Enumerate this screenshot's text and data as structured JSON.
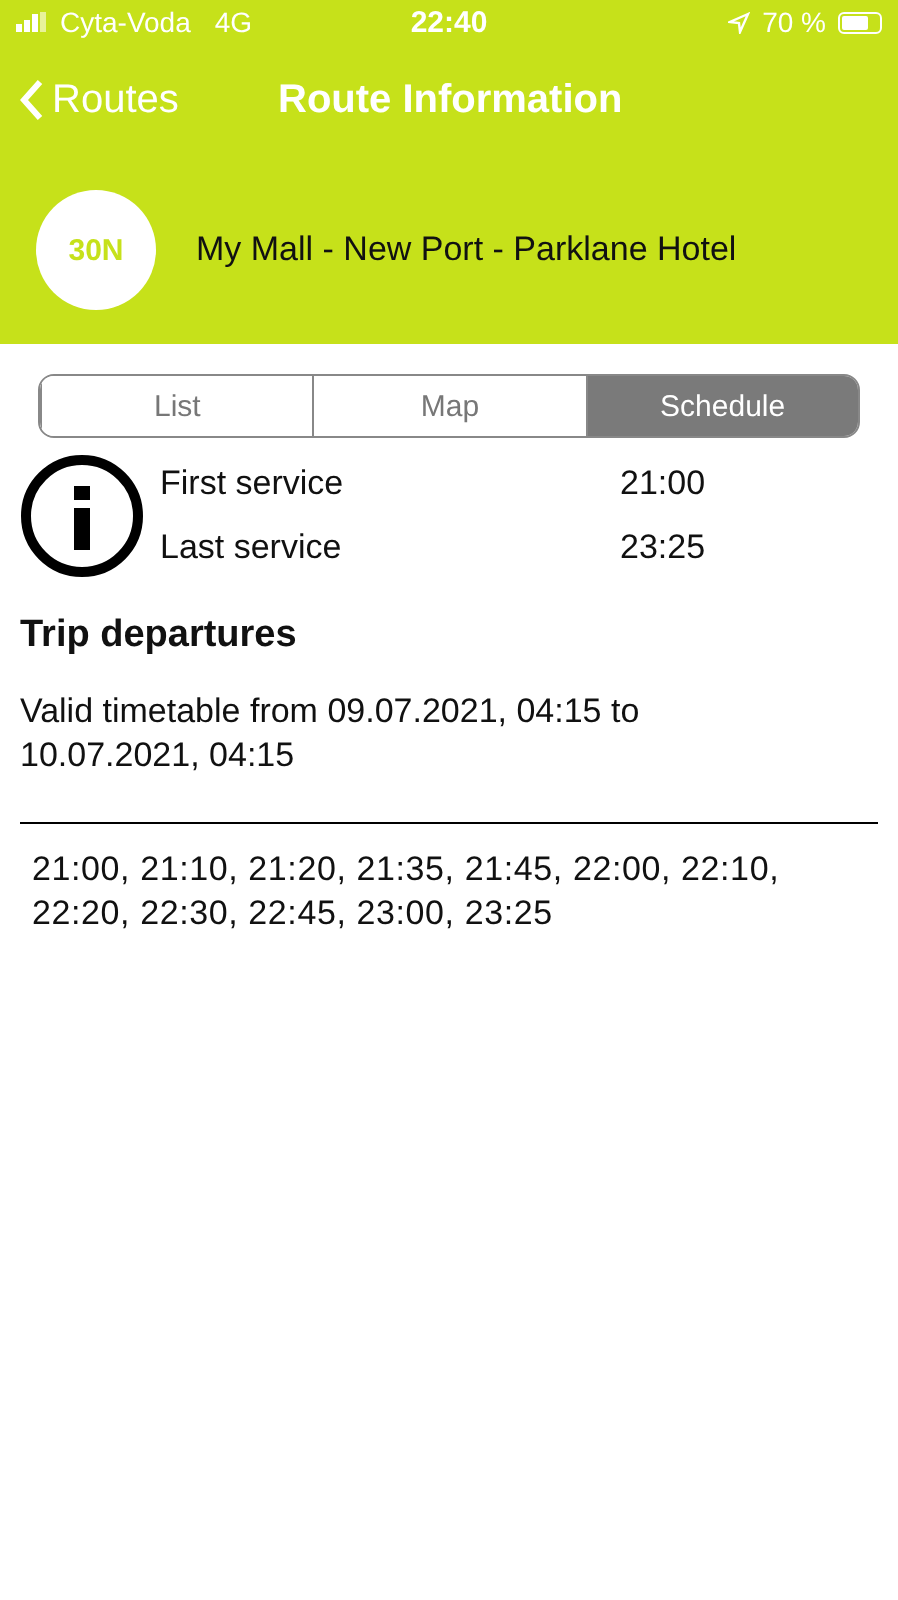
{
  "status_bar": {
    "carrier": "Cyta-Voda",
    "network": "4G",
    "time": "22:40",
    "battery_text": "70 %"
  },
  "nav": {
    "back": "Routes",
    "title": "Route Information"
  },
  "route": {
    "number": "30N",
    "name": "My Mall - New Port - Parklane Hotel"
  },
  "tabs": [
    {
      "label": "List",
      "selected": false
    },
    {
      "label": "Map",
      "selected": false
    },
    {
      "label": "Schedule",
      "selected": true
    }
  ],
  "services": [
    {
      "label": "First service",
      "time": "21:00"
    },
    {
      "label": "Last service",
      "time": "23:25"
    }
  ],
  "departures": {
    "heading": "Trip departures",
    "validity": "Valid timetable from 09.07.2021, 04:15 to 10.07.2021, 04:15",
    "times": "21:00, 21:10, 21:20, 21:35, 21:45, 22:00, 22:10, 22:20, 22:30, 22:45, 23:00, 23:25"
  }
}
